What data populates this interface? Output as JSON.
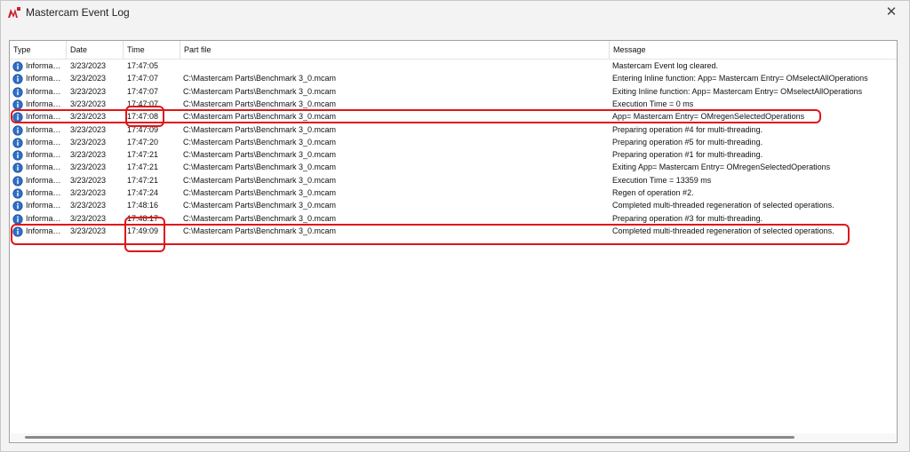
{
  "window": {
    "title": "Mastercam Event Log",
    "close_label": "✕",
    "accent_color": "#cc1f2f"
  },
  "columns": [
    "Type",
    "Date",
    "Time",
    "Part file",
    "Message"
  ],
  "rows": [
    {
      "type": "Informa…",
      "date": "3/23/2023",
      "time": "17:47:05",
      "part": "",
      "message": "Mastercam Event log cleared."
    },
    {
      "type": "Informa…",
      "date": "3/23/2023",
      "time": "17:47:07",
      "part": "C:\\Mastercam Parts\\Benchmark 3_0.mcam",
      "message": "Entering Inline function: App= Mastercam Entry= OMselectAllOperations"
    },
    {
      "type": "Informa…",
      "date": "3/23/2023",
      "time": "17:47:07",
      "part": "C:\\Mastercam Parts\\Benchmark 3_0.mcam",
      "message": "Exiting Inline function: App= Mastercam Entry= OMselectAllOperations"
    },
    {
      "type": "Informa…",
      "date": "3/23/2023",
      "time": "17:47:07",
      "part": "C:\\Mastercam Parts\\Benchmark 3_0.mcam",
      "message": "Execution Time = 0 ms"
    },
    {
      "type": "Informa…",
      "date": "3/23/2023",
      "time": "17:47:08",
      "part": "C:\\Mastercam Parts\\Benchmark 3_0.mcam",
      "message": "App= Mastercam Entry= OMregenSelectedOperations"
    },
    {
      "type": "Informa…",
      "date": "3/23/2023",
      "time": "17:47:09",
      "part": "C:\\Mastercam Parts\\Benchmark 3_0.mcam",
      "message": "Preparing operation #4 for multi-threading."
    },
    {
      "type": "Informa…",
      "date": "3/23/2023",
      "time": "17:47:20",
      "part": "C:\\Mastercam Parts\\Benchmark 3_0.mcam",
      "message": "Preparing operation #5 for multi-threading."
    },
    {
      "type": "Informa…",
      "date": "3/23/2023",
      "time": "17:47:21",
      "part": "C:\\Mastercam Parts\\Benchmark 3_0.mcam",
      "message": "Preparing operation #1 for multi-threading."
    },
    {
      "type": "Informa…",
      "date": "3/23/2023",
      "time": "17:47:21",
      "part": "C:\\Mastercam Parts\\Benchmark 3_0.mcam",
      "message": "Exiting App= Mastercam Entry= OMregenSelectedOperations"
    },
    {
      "type": "Informa…",
      "date": "3/23/2023",
      "time": "17:47:21",
      "part": "C:\\Mastercam Parts\\Benchmark 3_0.mcam",
      "message": "Execution Time = 13359 ms"
    },
    {
      "type": "Informa…",
      "date": "3/23/2023",
      "time": "17:47:24",
      "part": "C:\\Mastercam Parts\\Benchmark 3_0.mcam",
      "message": "Regen of operation #2."
    },
    {
      "type": "Informa…",
      "date": "3/23/2023",
      "time": "17:48:16",
      "part": "C:\\Mastercam Parts\\Benchmark 3_0.mcam",
      "message": "Completed multi-threaded regeneration of selected operations."
    },
    {
      "type": "Informa…",
      "date": "3/23/2023",
      "time": "17:48:17",
      "part": "C:\\Mastercam Parts\\Benchmark 3_0.mcam",
      "message": "Preparing operation #3 for multi-threading."
    },
    {
      "type": "Informa…",
      "date": "3/23/2023",
      "time": "17:49:09",
      "part": "C:\\Mastercam Parts\\Benchmark 3_0.mcam",
      "message": "Completed multi-threaded regeneration of selected operations."
    }
  ],
  "annotations": {
    "color": "#e0161a"
  }
}
